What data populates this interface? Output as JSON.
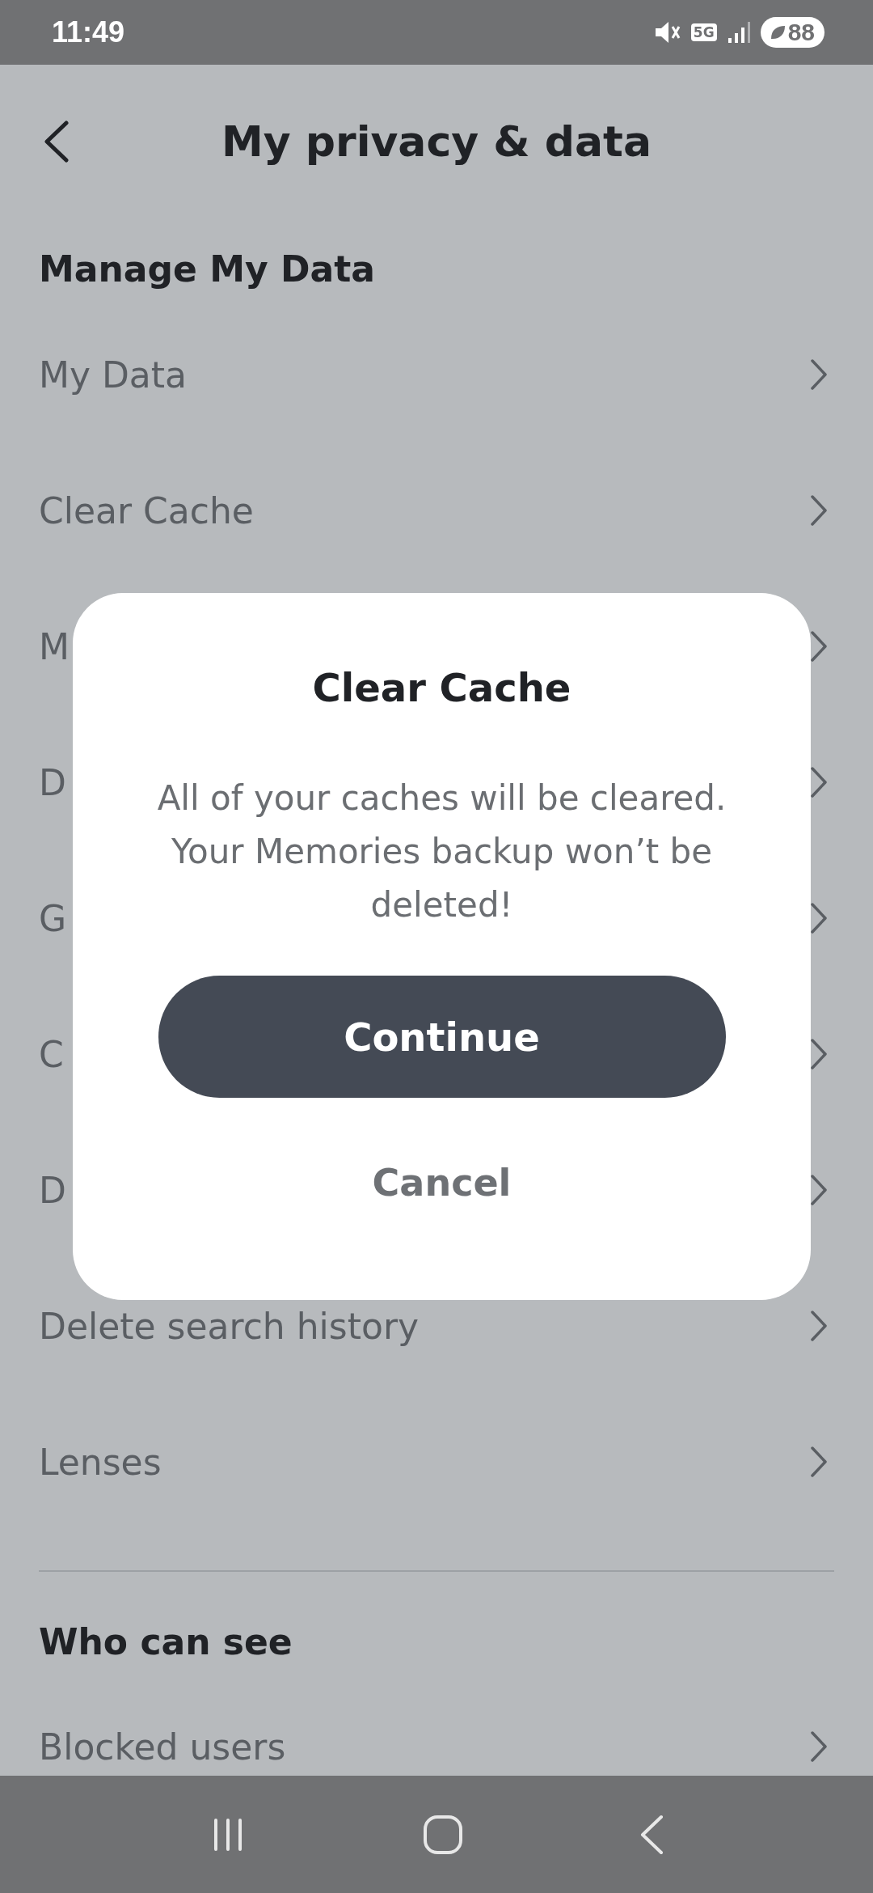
{
  "status_bar": {
    "time": "11:49",
    "network": "5G",
    "battery": "88"
  },
  "header": {
    "title": "My privacy & data"
  },
  "sections": [
    {
      "title": "Manage My Data",
      "items": [
        "My Data",
        "Clear Cache",
        "M",
        "D",
        "G",
        "C",
        "D",
        "Delete search history",
        "Lenses"
      ]
    },
    {
      "title": "Who can see",
      "items": [
        "Blocked users"
      ]
    }
  ],
  "dialog": {
    "title": "Clear Cache",
    "message": "All of your caches will be cleared. Your Memories backup won’t be deleted!",
    "primary_button": "Continue",
    "secondary_button": "Cancel"
  }
}
